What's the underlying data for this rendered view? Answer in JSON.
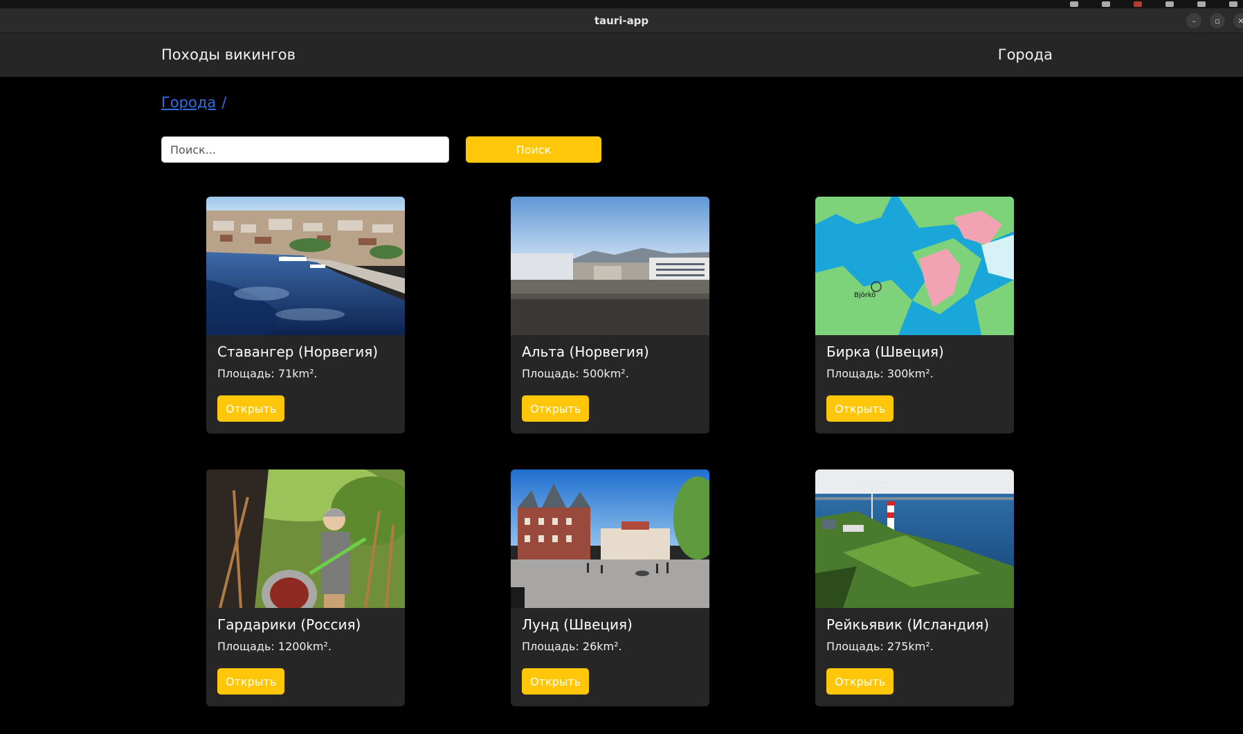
{
  "window": {
    "title": "tauri-app",
    "controls": {
      "minimize_glyph": "–",
      "maximize_glyph": "▫",
      "close_glyph": "✕"
    }
  },
  "header": {
    "brand": "Походы викингов",
    "nav_cities": "Города"
  },
  "breadcrumb": {
    "items": [
      "Города"
    ],
    "separator": "/"
  },
  "search": {
    "placeholder": "Поиск...",
    "value": "",
    "button_label": "Поиск"
  },
  "colors": {
    "accent": "#ffc60a",
    "link": "#2f6ee8",
    "card_bg": "#262626",
    "page_bg": "#000000"
  },
  "cities": [
    {
      "title": "Ставангер (Норвегия)",
      "area": "Площадь: 71km².",
      "button": "Открыть",
      "image": "harbor-city-photo"
    },
    {
      "title": "Альта (Норвегия)",
      "area": "Площадь: 500km².",
      "button": "Открыть",
      "image": "rooftop-city-photo"
    },
    {
      "title": "Бирка (Швеция)",
      "area": "Площадь: 300km².",
      "button": "Открыть",
      "image": "lake-map-image",
      "map_label": "Björkö"
    },
    {
      "title": "Гардарики (Россия)",
      "area": "Площадь: 1200km².",
      "button": "Открыть",
      "image": "viking-reenactor-photo"
    },
    {
      "title": "Лунд (Швеция)",
      "area": "Площадь: 26km².",
      "button": "Открыть",
      "image": "town-square-photo"
    },
    {
      "title": "Рейкьявик (Исландия)",
      "area": "Площадь: 275km².",
      "button": "Открыть",
      "image": "coastal-lighthouse-photo"
    }
  ]
}
